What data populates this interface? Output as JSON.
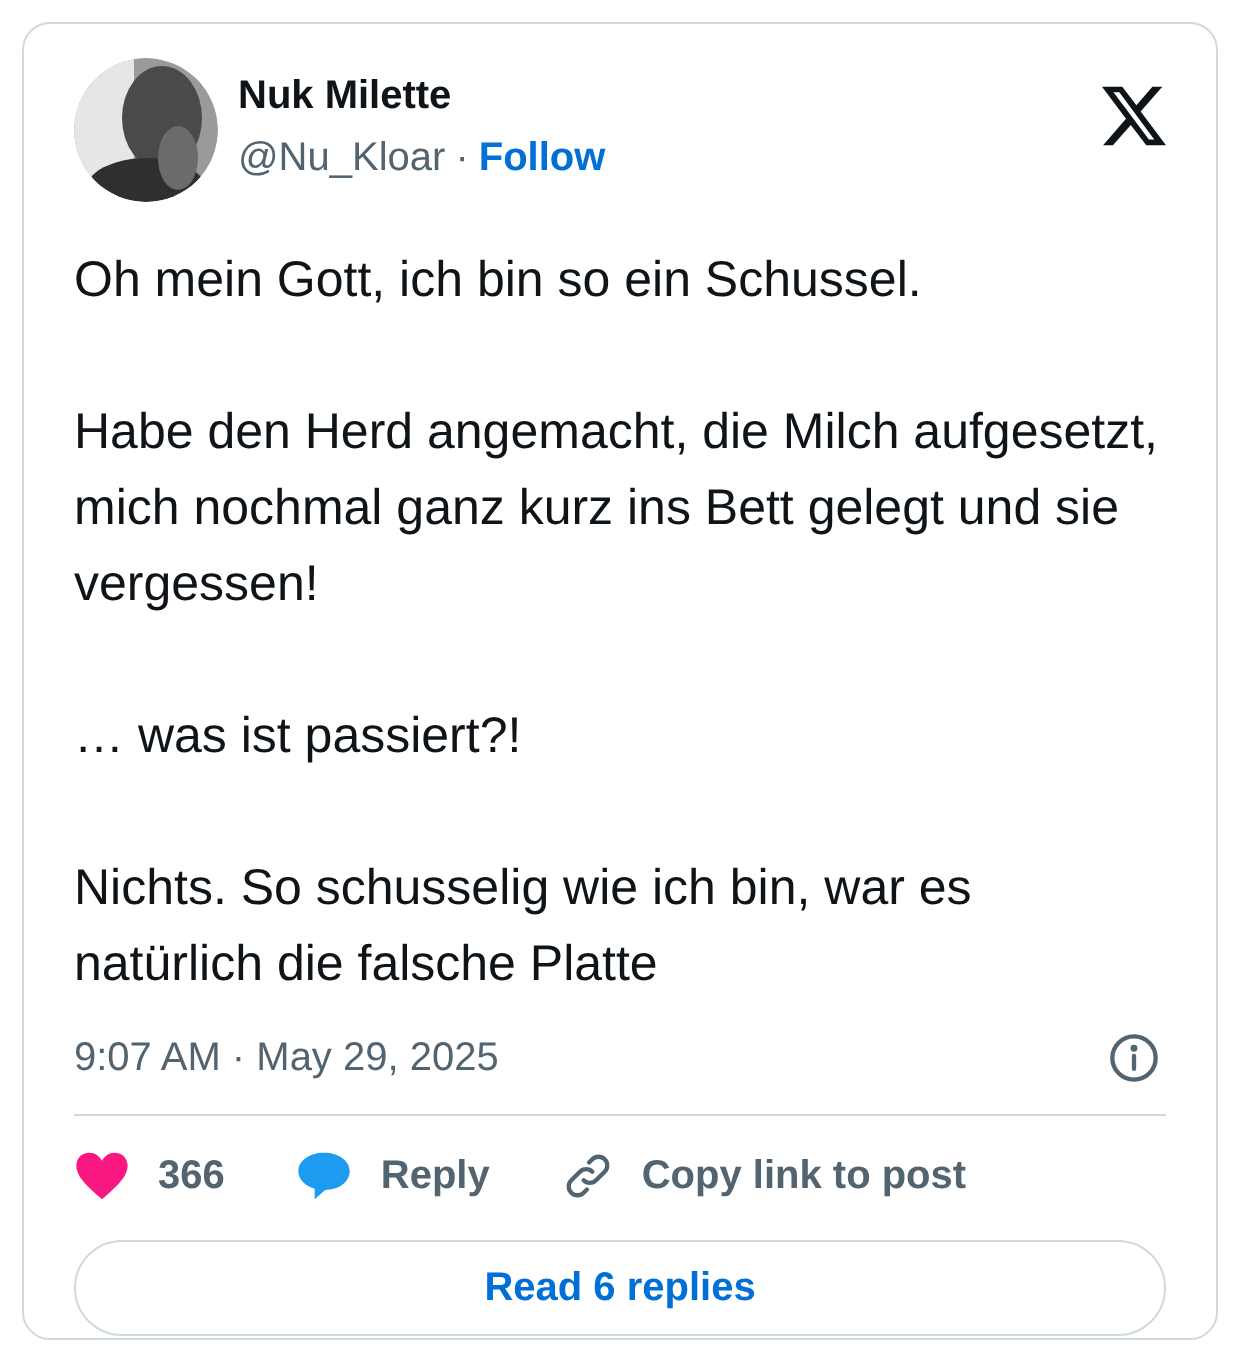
{
  "author": {
    "name": "Nuk Milette",
    "handle": "@Nu_Kloar",
    "separator": "·",
    "follow": "Follow"
  },
  "paragraphs": [
    "Oh mein Gott, ich bin so ein Schussel.",
    "Habe den Herd angemacht, die Milch aufgesetzt, mich nochmal ganz kurz ins Bett gelegt und sie vergessen!",
    "… was ist passiert?!",
    "Nichts. So schusselig wie ich bin, war es natürlich die falsche Platte"
  ],
  "timestamp": "9:07 AM · May 29, 2025",
  "actions": [
    {
      "kind": "like",
      "label": "366"
    },
    {
      "kind": "reply",
      "label": "Reply"
    },
    {
      "kind": "copy",
      "label": "Copy link to post"
    }
  ],
  "read_replies": "Read 6 replies"
}
